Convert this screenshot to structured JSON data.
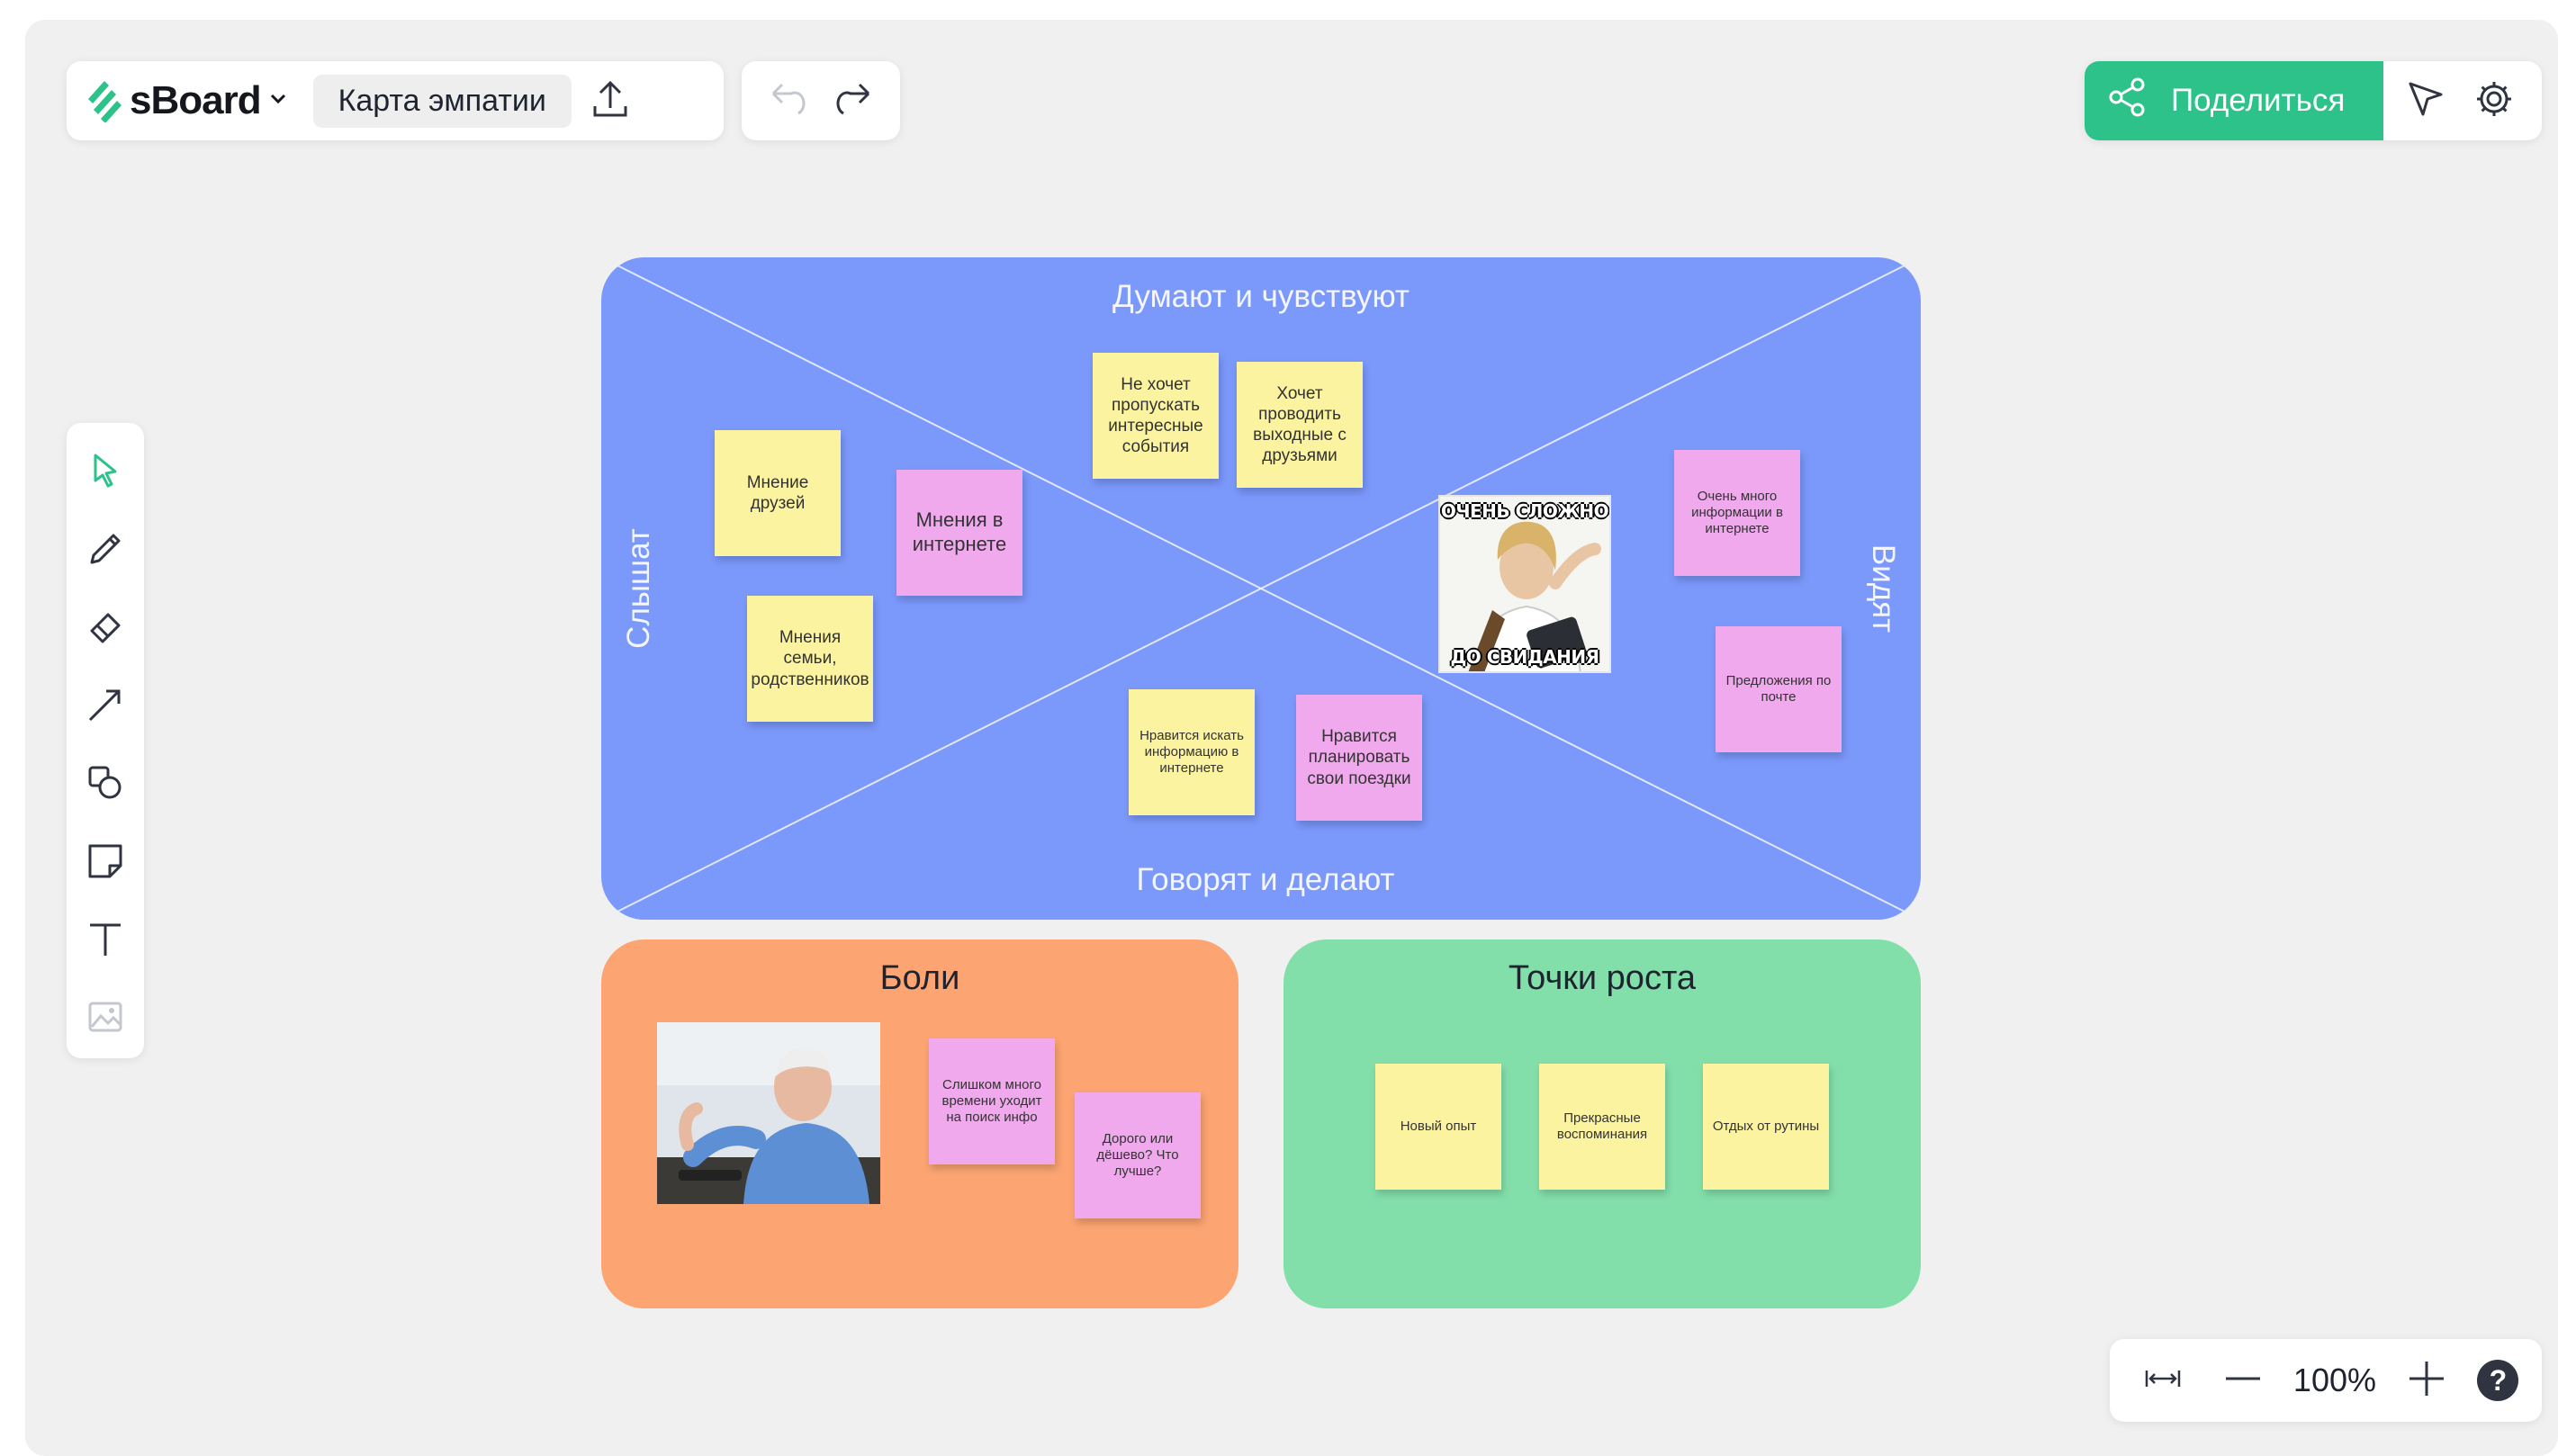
{
  "app": {
    "logo": "sBoard",
    "board_title": "Карта эмпатии"
  },
  "colors": {
    "accent": "#2ec28b",
    "empathy_frame": "#7b98fb",
    "pains_frame": "#fca472",
    "growth_frame": "#83dfaa",
    "sticky_yellow": "#fbf3a0",
    "sticky_pink": "#f0a9ec"
  },
  "header": {
    "icons": [
      "sboard-logo-icon",
      "chevron-down-icon",
      "upload-icon",
      "undo-icon",
      "redo-icon"
    ],
    "share_label": "Поделиться",
    "right_icons": [
      "share-icon",
      "cursor-icon",
      "gear-icon"
    ]
  },
  "tools": [
    "select-tool-icon",
    "pen-tool-icon",
    "eraser-tool-icon",
    "arrow-tool-icon",
    "shapes-tool-icon",
    "sticky-tool-icon",
    "text-tool-icon",
    "image-tool-icon"
  ],
  "zoom": {
    "value": "100%",
    "help": "?"
  },
  "empathy_map": {
    "label_top": "Думают и чувствуют",
    "label_bottom": "Говорят и делают",
    "label_left": "Слышат",
    "label_right": "Видят",
    "stickies": [
      {
        "text": "Не хочет пропускать интересные события",
        "color": "yellow"
      },
      {
        "text": "Хочет проводить выходные с друзьями",
        "color": "yellow"
      },
      {
        "text": "Мнение друзей",
        "color": "yellow"
      },
      {
        "text": "Мнения в интернете",
        "color": "pink"
      },
      {
        "text": "Мнения семьи, родственников",
        "color": "yellow"
      },
      {
        "text": "Очень много информации в интернете",
        "color": "pink"
      },
      {
        "text": "Предложения по почте",
        "color": "pink"
      },
      {
        "text": "Нравится искать информацию в интернете",
        "color": "yellow"
      },
      {
        "text": "Нравится планировать свои поездки",
        "color": "pink"
      }
    ],
    "meme": {
      "top": "ОЧЕНЬ СЛОЖНО",
      "bottom": "ДО СВИДАНИЯ"
    }
  },
  "pains": {
    "title": "Боли",
    "stickies": [
      {
        "text": "Слишком много времени уходит на поиск инфо",
        "color": "pink"
      },
      {
        "text": "Дорого или дёшево? Что лучше?",
        "color": "pink"
      }
    ]
  },
  "growth": {
    "title": "Точки роста",
    "stickies": [
      {
        "text": "Новый опыт",
        "color": "yellow"
      },
      {
        "text": "Прекрасные воспоминания",
        "color": "yellow"
      },
      {
        "text": "Отдых от рутины",
        "color": "yellow"
      }
    ]
  }
}
